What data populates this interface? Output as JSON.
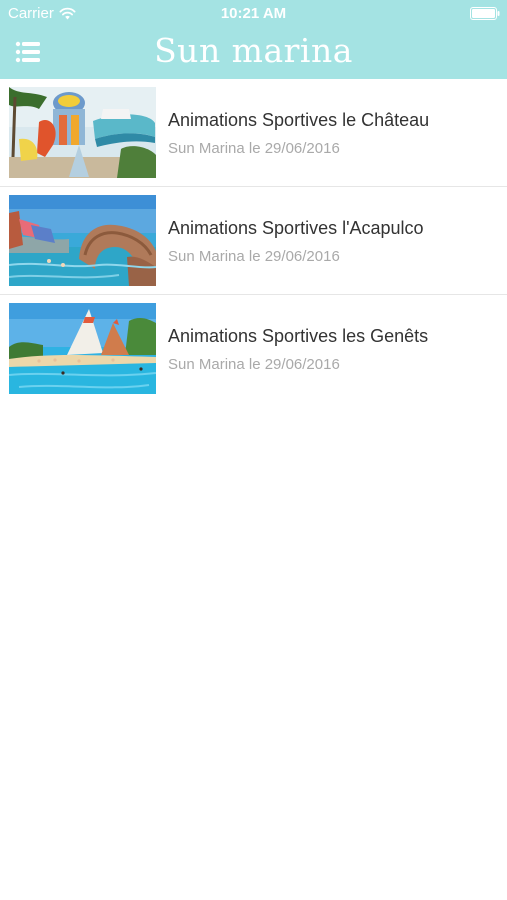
{
  "status_bar": {
    "carrier": "Carrier",
    "time": "10:21 AM"
  },
  "nav": {
    "title": "Sun marina",
    "menu_icon": "hamburger-menu-icon"
  },
  "colors": {
    "header_background": "#a4e3e3",
    "title_text": "#333333",
    "subtitle_text": "#a9a9a9"
  },
  "items": [
    {
      "title": "Animations Sportives le Château",
      "subtitle": "Sun Marina le 29/06/2016",
      "image": "waterslide-photo"
    },
    {
      "title": "Animations Sportives l'Acapulco",
      "subtitle": "Sun Marina le 29/06/2016",
      "image": "pool-bridge-photo"
    },
    {
      "title": "Animations Sportives les Genêts",
      "subtitle": "Sun Marina le 29/06/2016",
      "image": "pool-beach-photo"
    }
  ]
}
